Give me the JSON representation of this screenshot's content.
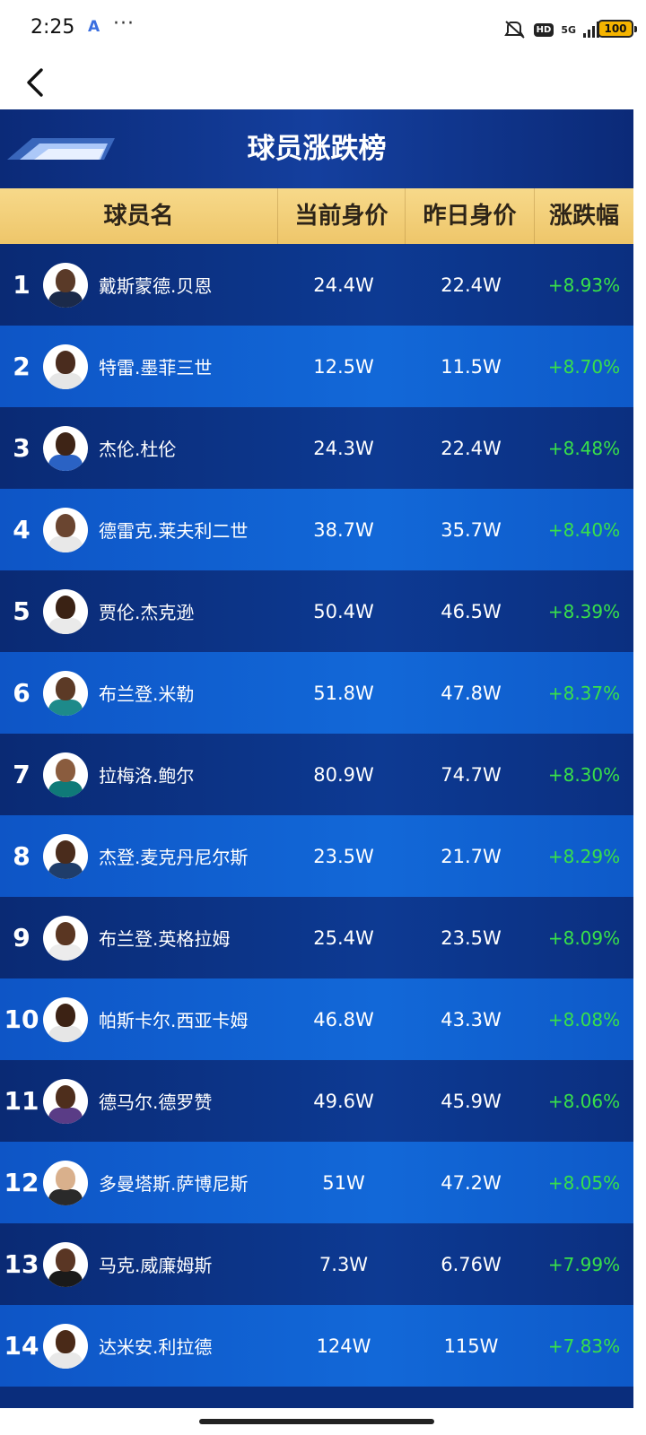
{
  "status": {
    "time": "2:25",
    "hd": "HD",
    "network": "5G",
    "battery": "100"
  },
  "board": {
    "title": "球员涨跌榜",
    "columns": {
      "name": "球员名",
      "current": "当前身价",
      "previous": "昨日身价",
      "change": "涨跌幅"
    },
    "rows": [
      {
        "rank": "1",
        "name": "戴斯蒙德.贝恩",
        "current": "24.4W",
        "previous": "22.4W",
        "change": "+8.93%"
      },
      {
        "rank": "2",
        "name": "特雷.墨菲三世",
        "current": "12.5W",
        "previous": "11.5W",
        "change": "+8.70%"
      },
      {
        "rank": "3",
        "name": "杰伦.杜伦",
        "current": "24.3W",
        "previous": "22.4W",
        "change": "+8.48%"
      },
      {
        "rank": "4",
        "name": "德雷克.莱夫利二世",
        "current": "38.7W",
        "previous": "35.7W",
        "change": "+8.40%"
      },
      {
        "rank": "5",
        "name": "贾伦.杰克逊",
        "current": "50.4W",
        "previous": "46.5W",
        "change": "+8.39%"
      },
      {
        "rank": "6",
        "name": "布兰登.米勒",
        "current": "51.8W",
        "previous": "47.8W",
        "change": "+8.37%"
      },
      {
        "rank": "7",
        "name": "拉梅洛.鲍尔",
        "current": "80.9W",
        "previous": "74.7W",
        "change": "+8.30%"
      },
      {
        "rank": "8",
        "name": "杰登.麦克丹尼尔斯",
        "current": "23.5W",
        "previous": "21.7W",
        "change": "+8.29%"
      },
      {
        "rank": "9",
        "name": "布兰登.英格拉姆",
        "current": "25.4W",
        "previous": "23.5W",
        "change": "+8.09%"
      },
      {
        "rank": "10",
        "name": "帕斯卡尔.西亚卡姆",
        "current": "46.8W",
        "previous": "43.3W",
        "change": "+8.08%"
      },
      {
        "rank": "11",
        "name": "德马尔.德罗赞",
        "current": "49.6W",
        "previous": "45.9W",
        "change": "+8.06%"
      },
      {
        "rank": "12",
        "name": "多曼塔斯.萨博尼斯",
        "current": "51W",
        "previous": "47.2W",
        "change": "+8.05%"
      },
      {
        "rank": "13",
        "name": "马克.威廉姆斯",
        "current": "7.3W",
        "previous": "6.76W",
        "change": "+7.99%"
      },
      {
        "rank": "14",
        "name": "达米安.利拉德",
        "current": "124W",
        "previous": "115W",
        "change": "+7.83%"
      }
    ]
  },
  "colors": {
    "positive": "#38e04a",
    "header_gold": "#f0c868",
    "board_dark": "#0a2d7c",
    "board_light": "#1268d8"
  },
  "avatars": [
    {
      "skin": "#5a3a28",
      "jersey": "#1b2a4a"
    },
    {
      "skin": "#4a2c1e",
      "jersey": "#e6e6e6"
    },
    {
      "skin": "#3e2416",
      "jersey": "#2a62c4"
    },
    {
      "skin": "#6a4530",
      "jersey": "#e8e8e8"
    },
    {
      "skin": "#3a2214",
      "jersey": "#eaeaea"
    },
    {
      "skin": "#5c3a26",
      "jersey": "#1d8a8a"
    },
    {
      "skin": "#8a5c3e",
      "jersey": "#0f7a78"
    },
    {
      "skin": "#4a2c1c",
      "jersey": "#1f3d6a"
    },
    {
      "skin": "#5a3622",
      "jersey": "#ececec"
    },
    {
      "skin": "#3c2214",
      "jersey": "#e6e6e6"
    },
    {
      "skin": "#4e2e1c",
      "jersey": "#5a3c86"
    },
    {
      "skin": "#d9b08c",
      "jersey": "#2a2a2a"
    },
    {
      "skin": "#5a3624",
      "jersey": "#1a1a1a"
    },
    {
      "skin": "#4a2a18",
      "jersey": "#e8e8e8"
    }
  ]
}
